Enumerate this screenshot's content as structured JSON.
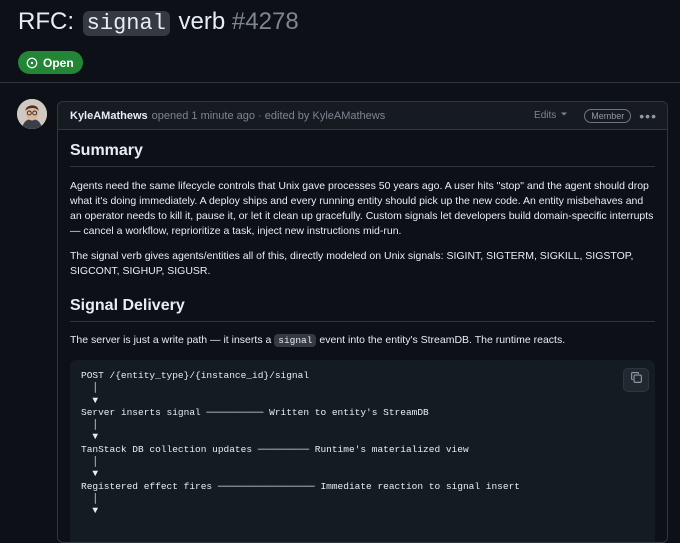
{
  "issue": {
    "title_prefix": "RFC: ",
    "title_code": "signal",
    "title_suffix": " verb ",
    "number": "#4278",
    "state": "Open"
  },
  "comment": {
    "author": "KyleAMathews",
    "meta": "opened 1 minute ago · edited by KyleAMathews",
    "edits_label": "Edits",
    "role_badge": "Member",
    "more_label": "•••"
  },
  "content": {
    "h_summary": "Summary",
    "p_summary_1": "Agents need the same lifecycle controls that Unix gave processes 50 years ago. A user hits \"stop\" and the agent should drop what it's doing immediately. A deploy ships and every running entity should pick up the new code. An entity misbehaves and an operator needs to kill it, pause it, or let it clean up gracefully. Custom signals let developers build domain-specific interrupts — cancel a workflow, reprioritize a task, inject new instructions mid-run.",
    "p_summary_2": "The signal verb gives agents/entities all of this, directly modeled on Unix signals: SIGINT, SIGTERM, SIGKILL, SIGSTOP, SIGCONT, SIGHUP, SIGUSR.",
    "h_delivery": "Signal Delivery",
    "p_delivery_pre": "The server is just a write path — it inserts a ",
    "p_delivery_code": "signal",
    "p_delivery_post": " event into the entity's StreamDB. The runtime reacts.",
    "code_block": "POST /{entity_type}/{instance_id}/signal\n  │\n  ▼\nServer inserts signal ────────── Written to entity's StreamDB\n  │\n  ▼\nTanStack DB collection updates ───────── Runtime's materialized view\n  │\n  ▼\nRegistered effect fires ───────────────── Immediate reaction to signal insert\n  │\n  ▼"
  },
  "colors": {
    "background": "#0d1117",
    "open_badge": "#238636",
    "border": "#30363d",
    "muted_text": "#7d8590"
  },
  "icons": {
    "state": "issue-opened-icon",
    "edits_caret": "triangle-down-icon",
    "copy": "copy-icon",
    "more": "kebab-horizontal-icon"
  }
}
